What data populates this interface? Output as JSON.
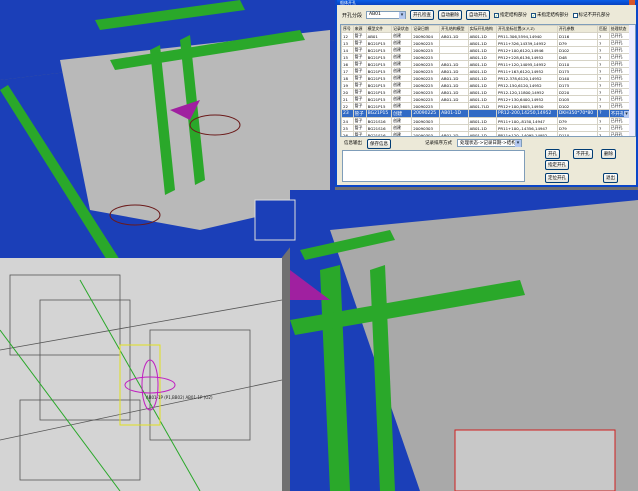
{
  "dialog": {
    "title": "船体开孔",
    "hole_part_label": "开孔分段",
    "hole_part_value": "AB01",
    "check_hole_btn": "开孔检查",
    "auto_delete_btn": "自动删除",
    "auto_hole_btn": "自动开孔",
    "checkboxes": [
      {
        "label": "指定结构部分",
        "checked": true
      },
      {
        "label": "未指定结构部分",
        "checked": true
      },
      {
        "label": "标记不开孔部分",
        "checked": false
      }
    ],
    "columns": [
      "序号",
      "来源",
      "模型文件",
      "记录状态",
      "记录日期",
      "开孔结构模型",
      "实际开孔结构",
      "开孔坐标位置(X,Y,Z)",
      "开孔参数",
      "匹配",
      "处理状态"
    ],
    "rows": [
      [
        "12",
        "管子",
        "AB01",
        "创建",
        "20090304",
        "AB01-1D",
        "AB01-1D",
        "PR11-306,5594,14940",
        "D116",
        "?",
        "已开孔"
      ],
      [
        "13",
        "管子",
        "BG21P15",
        "创建",
        "20090225",
        "",
        "AB01-1D",
        "PR11+326,14339,14952",
        "D79",
        "?",
        "已开孔"
      ],
      [
        "14",
        "管子",
        "BG21P15",
        "创建",
        "20090225",
        "",
        "AB01-1D",
        "PR12+100,6120,14946",
        "D102",
        "?",
        "已开孔"
      ],
      [
        "15",
        "管子",
        "BG21P15",
        "创建",
        "20090225",
        "",
        "AB01-1D",
        "PR12+228,6136,14952",
        "D48",
        "?",
        "已开孔"
      ],
      [
        "16",
        "管子",
        "BG21P15",
        "创建",
        "20090225",
        "AB01-1D",
        "AB01-1D",
        "PR11+120,14095,14952",
        "D110",
        "?",
        "已开孔"
      ],
      [
        "17",
        "管子",
        "BG21P15",
        "创建",
        "20090225",
        "AB01-1D",
        "AB01-1D",
        "PR11+163,6120,14952",
        "D175",
        "?",
        "已开孔"
      ],
      [
        "18",
        "管子",
        "BG21P15",
        "创建",
        "20090225",
        "AB01-1D",
        "AB01-1D",
        "PR12-378,6120,14952",
        "D140",
        "?",
        "已开孔"
      ],
      [
        "19",
        "管子",
        "BG21P15",
        "创建",
        "20090225",
        "AB01-1D",
        "AB01-1D",
        "PR12-150,6120,14952",
        "D175",
        "?",
        "已开孔"
      ],
      [
        "20",
        "管子",
        "BG21P15",
        "创建",
        "20090225",
        "AB01-1D",
        "AB01-1D",
        "PR12-120,11800,14952",
        "D220",
        "?",
        "已开孔"
      ],
      [
        "21",
        "管子",
        "BG21P15",
        "创建",
        "20090225",
        "AB01-1D",
        "AB01-1D",
        "PR12+130,6400,14952",
        "D105",
        "?",
        "已开孔"
      ],
      [
        "22",
        "管子",
        "BG21P15",
        "创建",
        "20090225",
        "",
        "AB01-7LD",
        "PR12+100,5605,14950",
        "D102",
        "?",
        "已开孔"
      ],
      [
        "23",
        "管子",
        "BG21P15",
        "创建",
        "20090225",
        "AB01-1D",
        "",
        "PR12-200,14250,14952",
        "DKH350*70*80",
        "?",
        "不开孔"
      ],
      [
        "24",
        "管子",
        "BG21S16",
        "创建",
        "20090303",
        "",
        "AB01-1D",
        "PR11+100,-8150,14947",
        "D79",
        "?",
        "已开孔"
      ],
      [
        "25",
        "管子",
        "BG21S16",
        "创建",
        "20090303",
        "",
        "AB01-1D",
        "PR11+100,-14356,14947",
        "D79",
        "?",
        "已开孔"
      ],
      [
        "26",
        "管子",
        "BG21S16",
        "创建",
        "20090303",
        "AB01-1D",
        "AB01-1D",
        "PR11+120,-14095,14952",
        "D110",
        "?",
        "已开孔"
      ],
      [
        "27",
        "管子",
        "BG21S16",
        "创建",
        "20090303",
        "AB01-1D",
        "AB01-1D",
        "PR11+200,-4400,14952",
        "D250",
        "?",
        "已开孔"
      ],
      [
        "28",
        "管子",
        "BG21S16",
        "创建",
        "20090303",
        "AB01-1D",
        "AB01-1D",
        "PR11+200,-6640,14952",
        "DKH373*99*85",
        "?",
        "已开孔"
      ],
      [
        "29",
        "管子",
        "BG21S16",
        "创建",
        "20090303",
        "AB01-1D",
        "AB01-1D",
        "PR12+200,-14250,14952",
        "D140",
        "?",
        "已开孔"
      ]
    ],
    "selected_row": "23",
    "info_output_label": "信息输出",
    "save_info_btn": "保存信息",
    "sort_label": "记录排序方式",
    "sort_value": "处理状态->记录日期->结构",
    "hole_btn": "开孔",
    "no_hole_btn": "不开孔",
    "delete_btn": "删除",
    "specify_hole_btn": "指定开孔",
    "locate_hole_btn": "定位开孔",
    "exit_btn": "退出"
  },
  "scene": {
    "inset_label": "AB01-1P (P1,BB02) AB01-1P (O2)"
  }
}
